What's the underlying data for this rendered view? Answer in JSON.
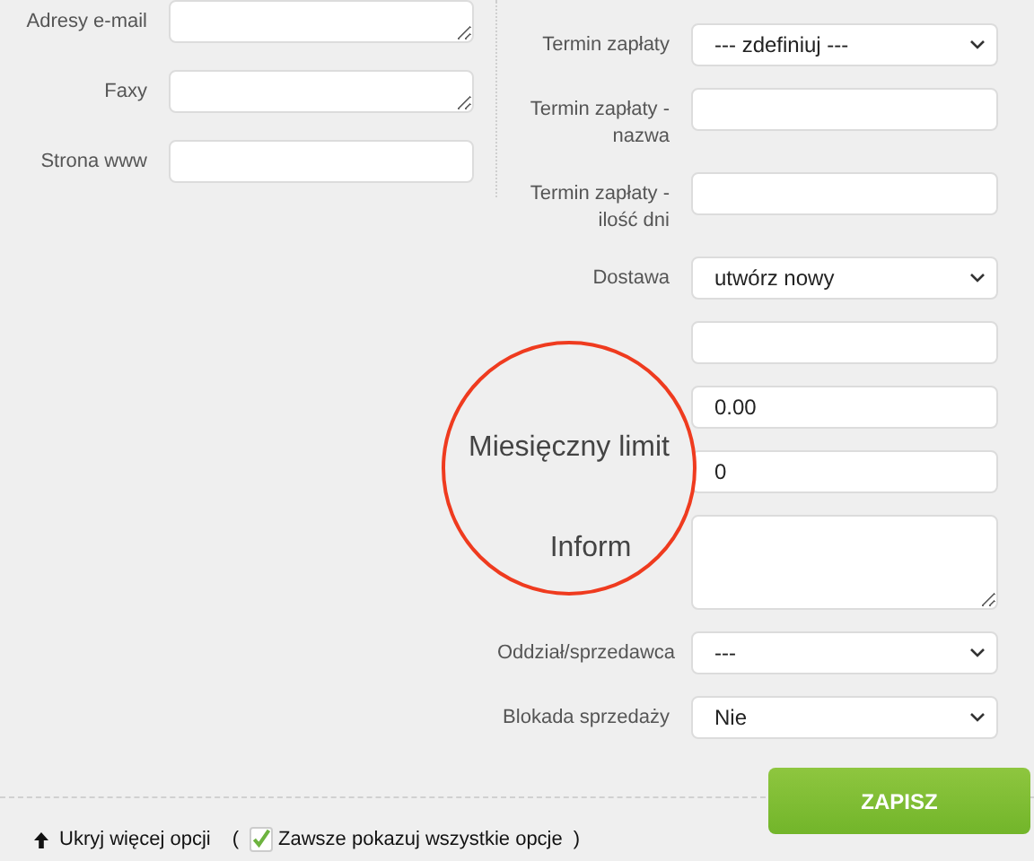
{
  "left_fields": [
    {
      "kind": "textarea",
      "label": "Adresy e-mail"
    },
    {
      "kind": "textarea",
      "label": "Faxy"
    },
    {
      "kind": "input",
      "label": "Strona www"
    }
  ],
  "right_fields": [
    {
      "kind": "select",
      "label": "Termin zapłaty",
      "value": "--- zdefiniuj ---"
    },
    {
      "kind": "input",
      "label": "Termin zapłaty - nazwa"
    },
    {
      "kind": "input",
      "label": "Termin zapłaty - ilość dni"
    },
    {
      "kind": "select",
      "label": "Dostawa",
      "value": "utwórz nowy"
    },
    {
      "kind": "input"
    },
    {
      "kind": "input",
      "value": "0.00"
    },
    {
      "kind": "input",
      "value": "0"
    },
    {
      "kind": "textarea"
    },
    {
      "kind": "select",
      "label": "Oddział/sprzedawca",
      "value": "---"
    },
    {
      "kind": "select",
      "label": "Blokada sprzedaży",
      "value": "Nie"
    }
  ],
  "magnifier": {
    "lines": [
      "Miesięczny limit",
      "Inform"
    ]
  },
  "footer": {
    "toggle_label": "Ukryj więcej opcji",
    "open_paren": "(",
    "always_show": {
      "label": "Zawsze pokazuj wszystkie opcje",
      "checked": true
    },
    "close_paren": ")",
    "save_button": "ZAPISZ"
  }
}
